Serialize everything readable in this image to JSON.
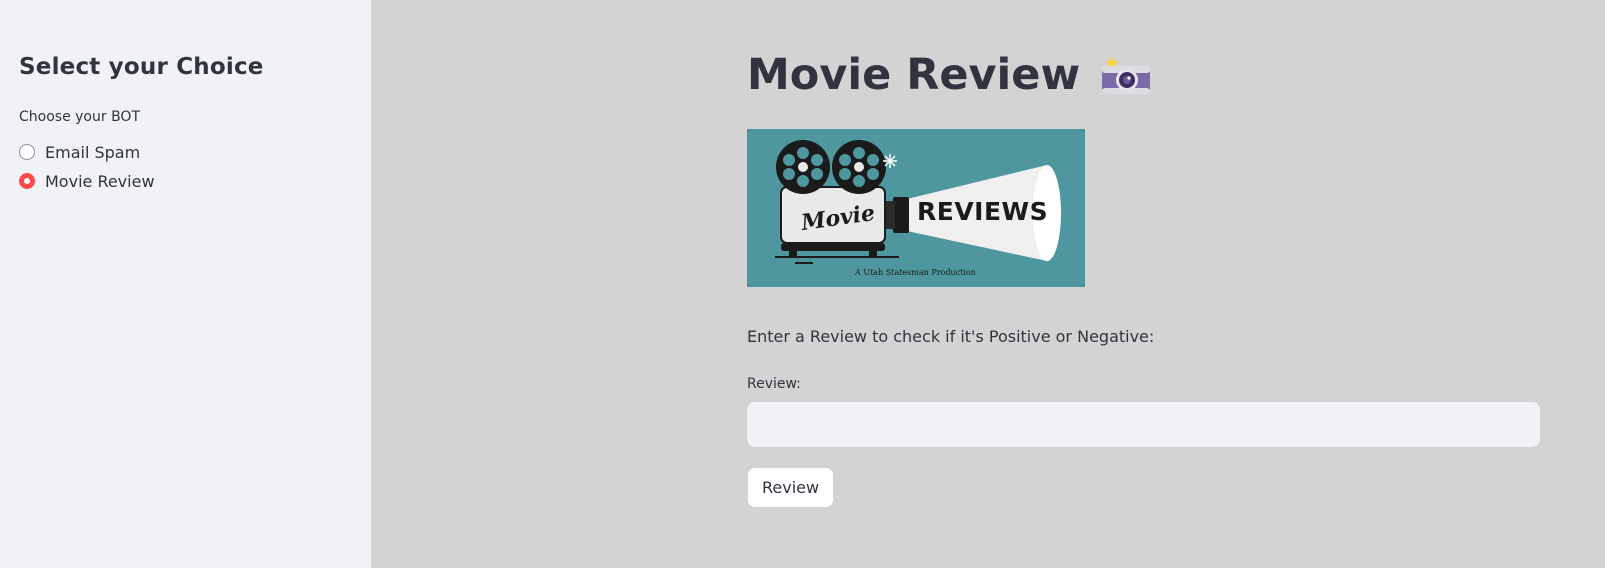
{
  "sidebar": {
    "title": "Select your Choice",
    "radio_label": "Choose your BOT",
    "options": [
      {
        "label": "Email Spam",
        "selected": false
      },
      {
        "label": "Movie Review",
        "selected": true
      }
    ]
  },
  "main": {
    "title": "Movie Review",
    "title_icon": "camera-with-flash-icon",
    "banner": {
      "icon": "film-projector-icon",
      "brand_script": "Movie",
      "brand_text": "REVIEWS",
      "credit": "A Utah Statesman Production"
    },
    "instruction": "Enter a Review to check if it's Positive or Negative:",
    "input": {
      "label": "Review:",
      "value": "",
      "placeholder": ""
    },
    "button_label": "Review"
  },
  "colors": {
    "accent": "#ff4b4b",
    "sidebar_bg": "#f0f2f6",
    "main_bg": "#d3d3d3",
    "text": "#31333f",
    "banner_bg": "#4f979e"
  }
}
